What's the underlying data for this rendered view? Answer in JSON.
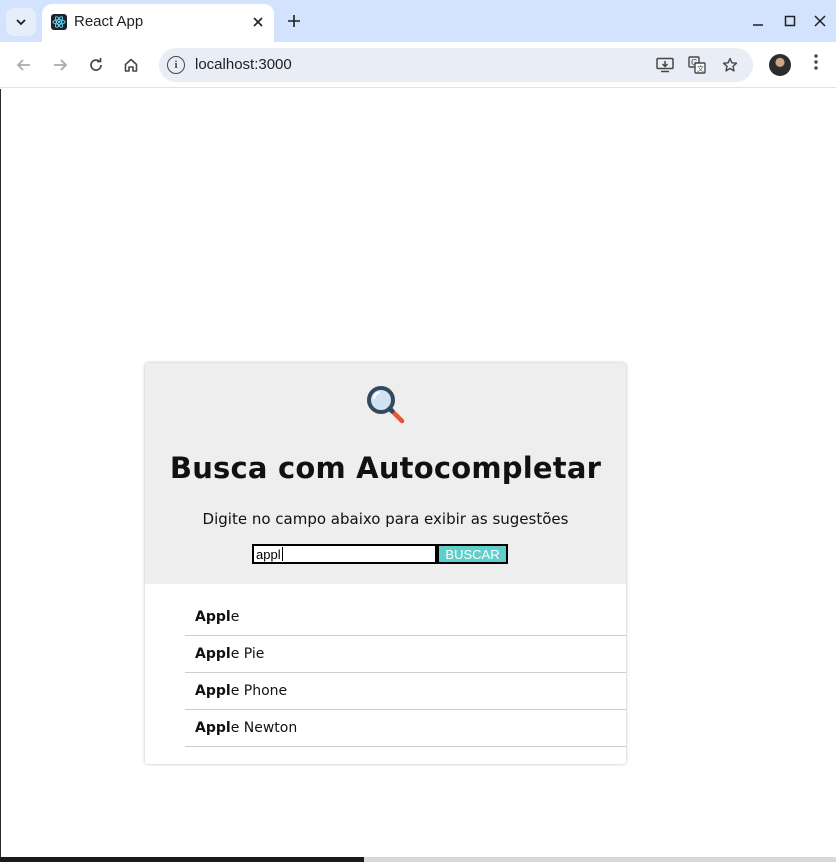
{
  "browser": {
    "tab_title": "React App",
    "url": "localhost:3000"
  },
  "page": {
    "title": "Busca com Autocompletar",
    "subtitle": "Digite no campo abaixo para exibir as sugestões",
    "search_value": "appl",
    "search_button_label": "BUSCAR",
    "suggestions": [
      {
        "match": "Appl",
        "rest": "e"
      },
      {
        "match": "Appl",
        "rest": "e Pie"
      },
      {
        "match": "Appl",
        "rest": "e Phone"
      },
      {
        "match": "Appl",
        "rest": "e Newton"
      }
    ]
  },
  "colors": {
    "tabbar": "#d3e3fd",
    "card_header": "#eeeeee",
    "button": "#5ecfca"
  },
  "icons": {
    "tab_search": "chevron-down-icon",
    "favicon": "react-logo-icon",
    "hero": "magnifying-glass-icon"
  }
}
